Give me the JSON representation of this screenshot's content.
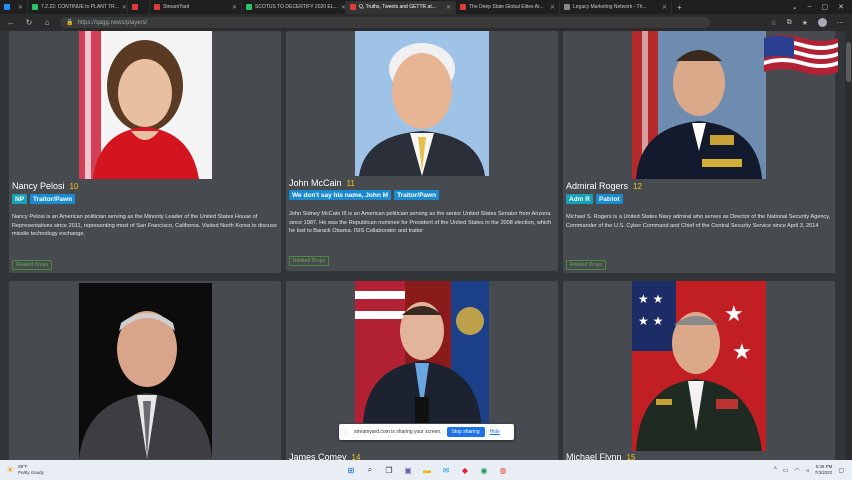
{
  "browser": {
    "tabs": [
      {
        "title": "",
        "color": "#1f8fff",
        "active": false
      },
      {
        "title": "7.2.22: CONTINUE to PLANT TR...",
        "color": "#29c36a",
        "active": false
      },
      {
        "title": "",
        "color": "#e03a3a",
        "active": false
      },
      {
        "title": "StreamYard",
        "color": "#e03a3a",
        "active": false
      },
      {
        "title": "SCOTUS TO DECERTIFY 2020 EL...",
        "color": "#29c36a",
        "active": false
      },
      {
        "title": "Q, Truths, Tweets and GETTR at...",
        "color": "#e03a3a",
        "active": true
      },
      {
        "title": "The Deep State Global Elites Ar...",
        "color": "#e03a3a",
        "active": false
      },
      {
        "title": "Legacy Marketing Network - Th...",
        "color": "#888888",
        "active": false
      }
    ],
    "new_tab": "+",
    "url": "https://qagg.news/players/",
    "window_controls": [
      "⌄",
      "–",
      "▢",
      "✕"
    ]
  },
  "cards": [
    {
      "name": "Nancy Pelosi",
      "score": "10",
      "tags": [
        "NP",
        "Traitor/Pawn"
      ],
      "description": "Nancy Pelosi is an American politician serving as the Minority Leader of the United States House of Representatives since 2011, representing most of San Francisco, California. Visited North Korea to discuss missile technology exchange.",
      "button": "Related Drops"
    },
    {
      "name": "John McCain",
      "score": "11",
      "tags": [
        "We don't say his name, John M",
        "Traitor/Pawn"
      ],
      "description": "John Sidney McCain III is an American politician serving as the senior United States Senator from Arizona since 1987. He was the Republican nominee for President of the United States in the 2008 election, which he lost to Barack Obama. ISIS Collaborator and traitor",
      "button": "Related Drops"
    },
    {
      "name": "Admiral Rogers",
      "score": "12",
      "tags": [
        "Adm R",
        "Patriot"
      ],
      "description": "Michael S. Rogers is a United States Navy admiral who serves as Director of the National Security Agency, Commander of the U.S. Cyber Command and Chief of the Central Security Service since April 3, 2014",
      "button": "Related Drops"
    },
    {
      "name": "",
      "score": "",
      "tags": [],
      "description": "",
      "button": ""
    },
    {
      "name": "James Comey",
      "score": "14",
      "tags": [],
      "description": "",
      "button": ""
    },
    {
      "name": "Michael Flynn",
      "score": "15",
      "tags": [],
      "description": "",
      "button": ""
    }
  ],
  "share_banner": {
    "message": "streamyard.com is sharing your screen.",
    "stop_label": "Stop sharing",
    "hide_label": "Hide"
  },
  "taskbar": {
    "weather_temp": "89°F",
    "weather_desc": "Partly cloudy",
    "time": "5:36 PM",
    "date": "7/3/2022"
  },
  "colors": {
    "score": "#f0c419",
    "tag": "#1a8bd1",
    "card_bg": "#474b4f",
    "page_bg": "#333639"
  }
}
